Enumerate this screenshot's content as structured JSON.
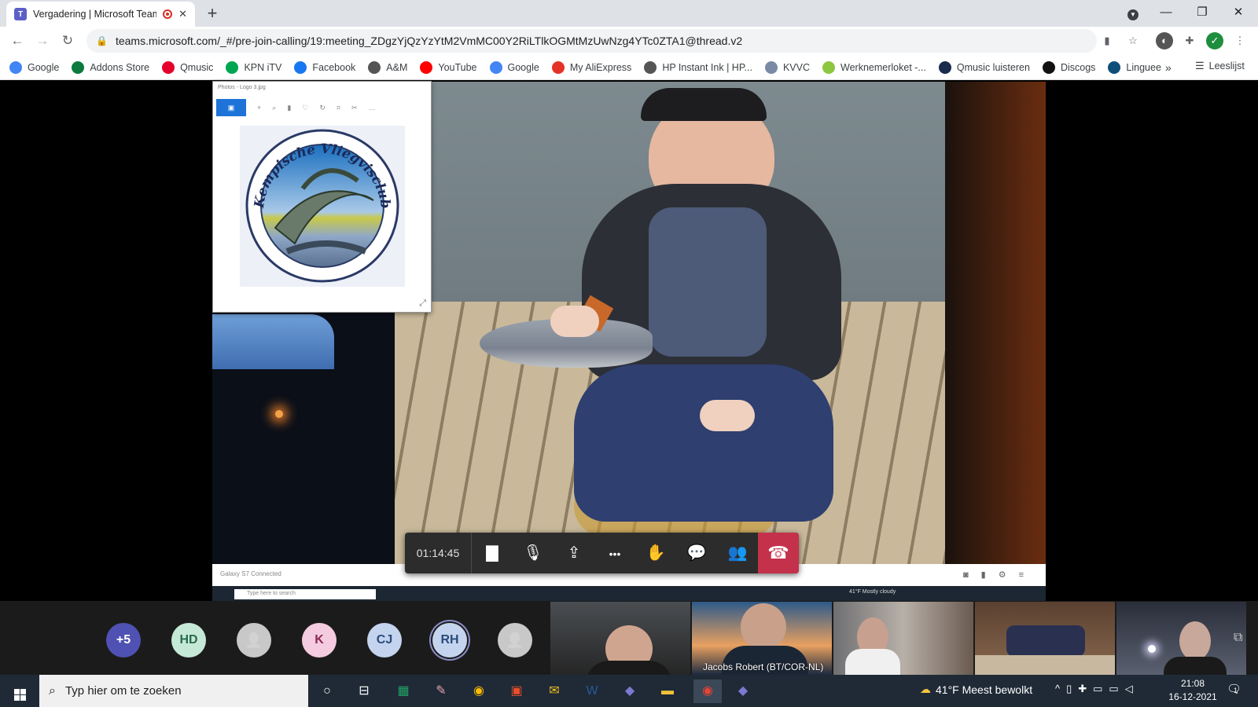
{
  "browser": {
    "tab_title": "Vergadering | Microsoft Teams",
    "tab_favicon": "teams-icon",
    "url": "teams.microsoft.com/_#/pre-join-calling/19:meeting_ZDgzYjQzYzYtM2VmMC00Y2RiLTlkOGMtMzUwNzg4YTc0ZTA1@thread.v2",
    "bookmarks": [
      {
        "label": "Google",
        "icon": "google-icon",
        "color": "#4285f4"
      },
      {
        "label": "Addons Store",
        "icon": "addons-store-icon",
        "color": "#0c7a3e"
      },
      {
        "label": "Qmusic",
        "icon": "qmusic-icon",
        "color": "#e4002b"
      },
      {
        "label": "KPN iTV",
        "icon": "kpn-icon",
        "color": "#00a651"
      },
      {
        "label": "Facebook",
        "icon": "facebook-icon",
        "color": "#1877f2"
      },
      {
        "label": "A&M",
        "icon": "globe-icon",
        "color": "#555555"
      },
      {
        "label": "YouTube",
        "icon": "youtube-icon",
        "color": "#ff0000"
      },
      {
        "label": "Google",
        "icon": "google-icon",
        "color": "#4285f4"
      },
      {
        "label": "My AliExpress",
        "icon": "aliexpress-icon",
        "color": "#e43225"
      },
      {
        "label": "HP Instant Ink | HP...",
        "icon": "globe-icon",
        "color": "#555555"
      },
      {
        "label": "KVVC",
        "icon": "kvvc-icon",
        "color": "#7a8aa6"
      },
      {
        "label": "Werknemerloket -...",
        "icon": "werknemerloket-icon",
        "color": "#8dc63f"
      },
      {
        "label": "Qmusic luisteren",
        "icon": "qmusic-icon",
        "color": "#1a2b4c"
      },
      {
        "label": "Discogs",
        "icon": "discogs-icon",
        "color": "#111111"
      },
      {
        "label": "Linguee",
        "icon": "linguee-icon",
        "color": "#0e4f7a"
      }
    ],
    "bookmarks_more": "»",
    "reading_list": "Leeslijst"
  },
  "shared_window": {
    "photos_title": "Photos - Logo 3.jpg",
    "logo_text": "Kempische Vliegvisclub",
    "status_text": "Galaxy S7 Connected",
    "taskbar_search": "Type here to search",
    "weather_text": "41°F  Mostly cloudy"
  },
  "call": {
    "timer": "01:14:45",
    "buttons": [
      {
        "name": "camera-button",
        "icon": "video-camera-icon",
        "glyph": "▇"
      },
      {
        "name": "mic-button",
        "icon": "microphone-icon",
        "glyph": "🎙"
      },
      {
        "name": "share-button",
        "icon": "share-screen-icon",
        "glyph": "⇪"
      },
      {
        "name": "more-actions-button",
        "icon": "more-icon",
        "glyph": "•••"
      },
      {
        "name": "raise-hand-button",
        "icon": "hand-icon",
        "glyph": "✋"
      },
      {
        "name": "chat-button",
        "icon": "chat-icon",
        "glyph": "💬"
      },
      {
        "name": "participants-button",
        "icon": "people-icon",
        "glyph": "👥"
      }
    ],
    "hangup_glyph": "☎",
    "colors": {
      "hangup": "#c4314b",
      "bar": "#2d2c2c"
    }
  },
  "participants": {
    "avatars": [
      {
        "label": "+5",
        "bg": "#4f52b2",
        "fg": "#ffffff"
      },
      {
        "label": "HD",
        "bg": "#c6e9d7",
        "fg": "#2a6a4a"
      },
      {
        "label": "",
        "bg": "#c8c8c8",
        "fg": "#555555",
        "icon": "person-icon"
      },
      {
        "label": "K",
        "bg": "#f4cbdf",
        "fg": "#8a2a55"
      },
      {
        "label": "CJ",
        "bg": "#c4d4ee",
        "fg": "#2a4a7a"
      },
      {
        "label": "RH",
        "bg": "#c4d4ee",
        "fg": "#2a4a7a",
        "active": true
      },
      {
        "label": "",
        "bg": "#c8c8c8",
        "fg": "#555555",
        "icon": "person-icon"
      }
    ],
    "video_tiles": [
      {
        "name": ""
      },
      {
        "name": "Jacobs Robert (BT/COR-NL)"
      },
      {
        "name": ""
      },
      {
        "name": ""
      },
      {
        "name": ""
      }
    ]
  },
  "taskbar": {
    "search_placeholder": "Typ hier om te zoeken",
    "weather": "41°F  Meest bewolkt",
    "time": "21:08",
    "date": "16-12-2021",
    "notification_count": "1"
  }
}
